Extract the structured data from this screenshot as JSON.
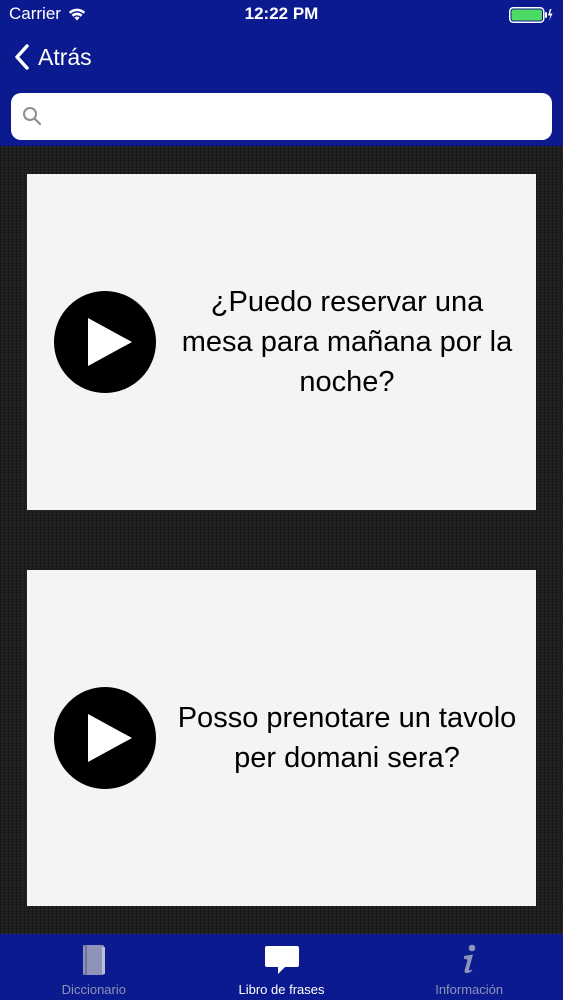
{
  "status_bar": {
    "carrier": "Carrier",
    "time": "12:22 PM",
    "battery_color": "#4cd964"
  },
  "nav": {
    "back_label": "Atrás"
  },
  "search": {
    "placeholder": "",
    "value": ""
  },
  "cards": [
    {
      "text": "¿Puedo reservar una mesa para mañana por la noche?"
    },
    {
      "text": "Posso prenotare un tavolo per domani sera?"
    }
  ],
  "tabs": [
    {
      "label": "Diccionario",
      "icon": "book-icon",
      "active": false
    },
    {
      "label": "Libro de frases",
      "icon": "speech-bubble-icon",
      "active": true
    },
    {
      "label": "Información",
      "icon": "info-icon",
      "active": false
    }
  ],
  "colors": {
    "nav_background": "#0b1b8f",
    "card_background": "#f4f4f6",
    "tab_inactive": "#8e93b8",
    "tab_active": "#ffffff"
  }
}
